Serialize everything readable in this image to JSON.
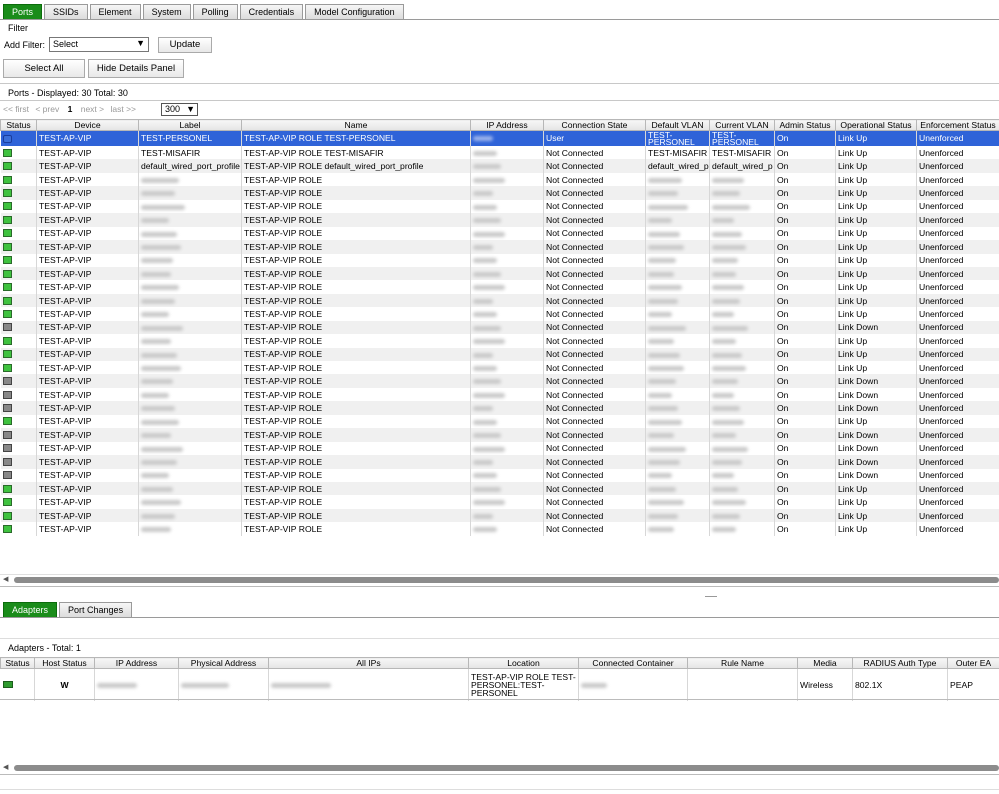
{
  "tabs": [
    "Ports",
    "SSIDs",
    "Element",
    "System",
    "Polling",
    "Credentials",
    "Model Configuration"
  ],
  "filter": {
    "title": "Filter",
    "add_label": "Add Filter:",
    "select_value": "Select",
    "update": "Update",
    "select_all": "Select All",
    "hide_details": "Hide Details Panel"
  },
  "ports_info": "Ports - Displayed: 30 Total: 30",
  "pager": {
    "first": "<< first",
    "prev": "< prev",
    "page": "1",
    "next": "next >",
    "last": "last >>",
    "per_page": "300"
  },
  "ports_columns": [
    "Status",
    "Device",
    "Label",
    "Name",
    "IP Address",
    "Connection State",
    "Default VLAN",
    "Current VLAN",
    "Admin Status",
    "Operational Status",
    "Enforcement Status"
  ],
  "ports_rows": [
    {
      "status": "user",
      "device": "TEST-AP-VIP",
      "label": "TEST-PERSONEL",
      "name": "TEST-AP-VIP ROLE TEST-PERSONEL",
      "conn": "User",
      "dvlan": "TEST-PERSONEL",
      "cvlan": "TEST-PERSONEL",
      "admin": "On",
      "oper": "Link Up",
      "enf": "Unenforced"
    },
    {
      "status": "up",
      "device": "TEST-AP-VIP",
      "label": "TEST-MISAFIR",
      "name": "TEST-AP-VIP ROLE TEST-MISAFIR",
      "conn": "Not Connected",
      "dvlan": "TEST-MISAFIR",
      "cvlan": "TEST-MISAFIR",
      "admin": "On",
      "oper": "Link Up",
      "enf": "Unenforced"
    },
    {
      "status": "up",
      "device": "TEST-AP-VIP",
      "label": "default_wired_port_profile",
      "name": "TEST-AP-VIP ROLE default_wired_port_profile",
      "conn": "Not Connected",
      "dvlan": "default_wired_p",
      "cvlan": "default_wired_p",
      "admin": "On",
      "oper": "Link Up",
      "enf": "Unenforced"
    },
    {
      "status": "up",
      "device": "TEST-AP-VIP",
      "label": "",
      "name": "TEST-AP-VIP ROLE",
      "conn": "Not Connected",
      "dvlan": "",
      "cvlan": "",
      "admin": "On",
      "oper": "Link Up",
      "enf": "Unenforced"
    },
    {
      "status": "up",
      "device": "TEST-AP-VIP",
      "label": "",
      "name": "TEST-AP-VIP ROLE",
      "conn": "Not Connected",
      "dvlan": "",
      "cvlan": "",
      "admin": "On",
      "oper": "Link Up",
      "enf": "Unenforced"
    },
    {
      "status": "up",
      "device": "TEST-AP-VIP",
      "label": "",
      "name": "TEST-AP-VIP ROLE",
      "conn": "Not Connected",
      "dvlan": "",
      "cvlan": "",
      "admin": "On",
      "oper": "Link Up",
      "enf": "Unenforced"
    },
    {
      "status": "up",
      "device": "TEST-AP-VIP",
      "label": "",
      "name": "TEST-AP-VIP ROLE",
      "conn": "Not Connected",
      "dvlan": "",
      "cvlan": "",
      "admin": "On",
      "oper": "Link Up",
      "enf": "Unenforced"
    },
    {
      "status": "up",
      "device": "TEST-AP-VIP",
      "label": "",
      "name": "TEST-AP-VIP ROLE",
      "conn": "Not Connected",
      "dvlan": "",
      "cvlan": "",
      "admin": "On",
      "oper": "Link Up",
      "enf": "Unenforced"
    },
    {
      "status": "up",
      "device": "TEST-AP-VIP",
      "label": "",
      "name": "TEST-AP-VIP ROLE",
      "conn": "Not Connected",
      "dvlan": "",
      "cvlan": "",
      "admin": "On",
      "oper": "Link Up",
      "enf": "Unenforced"
    },
    {
      "status": "up",
      "device": "TEST-AP-VIP",
      "label": "",
      "name": "TEST-AP-VIP ROLE",
      "conn": "Not Connected",
      "dvlan": "",
      "cvlan": "",
      "admin": "On",
      "oper": "Link Up",
      "enf": "Unenforced"
    },
    {
      "status": "up",
      "device": "TEST-AP-VIP",
      "label": "",
      "name": "TEST-AP-VIP ROLE",
      "conn": "Not Connected",
      "dvlan": "",
      "cvlan": "",
      "admin": "On",
      "oper": "Link Up",
      "enf": "Unenforced"
    },
    {
      "status": "up",
      "device": "TEST-AP-VIP",
      "label": "",
      "name": "TEST-AP-VIP ROLE",
      "conn": "Not Connected",
      "dvlan": "",
      "cvlan": "",
      "admin": "On",
      "oper": "Link Up",
      "enf": "Unenforced"
    },
    {
      "status": "up",
      "device": "TEST-AP-VIP",
      "label": "",
      "name": "TEST-AP-VIP ROLE",
      "conn": "Not Connected",
      "dvlan": "",
      "cvlan": "",
      "admin": "On",
      "oper": "Link Up",
      "enf": "Unenforced"
    },
    {
      "status": "up",
      "device": "TEST-AP-VIP",
      "label": "",
      "name": "TEST-AP-VIP ROLE",
      "conn": "Not Connected",
      "dvlan": "",
      "cvlan": "",
      "admin": "On",
      "oper": "Link Up",
      "enf": "Unenforced"
    },
    {
      "status": "down",
      "device": "TEST-AP-VIP",
      "label": "",
      "name": "TEST-AP-VIP ROLE",
      "conn": "Not Connected",
      "dvlan": "",
      "cvlan": "",
      "admin": "On",
      "oper": "Link Down",
      "enf": "Unenforced"
    },
    {
      "status": "up",
      "device": "TEST-AP-VIP",
      "label": "",
      "name": "TEST-AP-VIP ROLE",
      "conn": "Not Connected",
      "dvlan": "",
      "cvlan": "",
      "admin": "On",
      "oper": "Link Up",
      "enf": "Unenforced"
    },
    {
      "status": "up",
      "device": "TEST-AP-VIP",
      "label": "",
      "name": "TEST-AP-VIP ROLE",
      "conn": "Not Connected",
      "dvlan": "",
      "cvlan": "",
      "admin": "On",
      "oper": "Link Up",
      "enf": "Unenforced"
    },
    {
      "status": "up",
      "device": "TEST-AP-VIP",
      "label": "",
      "name": "TEST-AP-VIP ROLE",
      "conn": "Not Connected",
      "dvlan": "",
      "cvlan": "",
      "admin": "On",
      "oper": "Link Up",
      "enf": "Unenforced"
    },
    {
      "status": "down",
      "device": "TEST-AP-VIP",
      "label": "",
      "name": "TEST-AP-VIP ROLE",
      "conn": "Not Connected",
      "dvlan": "",
      "cvlan": "",
      "admin": "On",
      "oper": "Link Down",
      "enf": "Unenforced"
    },
    {
      "status": "down",
      "device": "TEST-AP-VIP",
      "label": "",
      "name": "TEST-AP-VIP ROLE",
      "conn": "Not Connected",
      "dvlan": "",
      "cvlan": "",
      "admin": "On",
      "oper": "Link Down",
      "enf": "Unenforced"
    },
    {
      "status": "down",
      "device": "TEST-AP-VIP",
      "label": "",
      "name": "TEST-AP-VIP ROLE",
      "conn": "Not Connected",
      "dvlan": "",
      "cvlan": "",
      "admin": "On",
      "oper": "Link Down",
      "enf": "Unenforced"
    },
    {
      "status": "up",
      "device": "TEST-AP-VIP",
      "label": "",
      "name": "TEST-AP-VIP ROLE",
      "conn": "Not Connected",
      "dvlan": "",
      "cvlan": "",
      "admin": "On",
      "oper": "Link Up",
      "enf": "Unenforced"
    },
    {
      "status": "down",
      "device": "TEST-AP-VIP",
      "label": "",
      "name": "TEST-AP-VIP ROLE",
      "conn": "Not Connected",
      "dvlan": "",
      "cvlan": "",
      "admin": "On",
      "oper": "Link Down",
      "enf": "Unenforced"
    },
    {
      "status": "down",
      "device": "TEST-AP-VIP",
      "label": "",
      "name": "TEST-AP-VIP ROLE",
      "conn": "Not Connected",
      "dvlan": "",
      "cvlan": "",
      "admin": "On",
      "oper": "Link Down",
      "enf": "Unenforced"
    },
    {
      "status": "down",
      "device": "TEST-AP-VIP",
      "label": "",
      "name": "TEST-AP-VIP ROLE",
      "conn": "Not Connected",
      "dvlan": "",
      "cvlan": "",
      "admin": "On",
      "oper": "Link Down",
      "enf": "Unenforced"
    },
    {
      "status": "down",
      "device": "TEST-AP-VIP",
      "label": "",
      "name": "TEST-AP-VIP ROLE",
      "conn": "Not Connected",
      "dvlan": "",
      "cvlan": "",
      "admin": "On",
      "oper": "Link Down",
      "enf": "Unenforced"
    },
    {
      "status": "up",
      "device": "TEST-AP-VIP",
      "label": "",
      "name": "TEST-AP-VIP ROLE",
      "conn": "Not Connected",
      "dvlan": "",
      "cvlan": "",
      "admin": "On",
      "oper": "Link Up",
      "enf": "Unenforced"
    },
    {
      "status": "up",
      "device": "TEST-AP-VIP",
      "label": "",
      "name": "TEST-AP-VIP ROLE",
      "conn": "Not Connected",
      "dvlan": "",
      "cvlan": "",
      "admin": "On",
      "oper": "Link Up",
      "enf": "Unenforced"
    },
    {
      "status": "up",
      "device": "TEST-AP-VIP",
      "label": "",
      "name": "TEST-AP-VIP ROLE",
      "conn": "Not Connected",
      "dvlan": "",
      "cvlan": "",
      "admin": "On",
      "oper": "Link Up",
      "enf": "Unenforced"
    },
    {
      "status": "up",
      "device": "TEST-AP-VIP",
      "label": "",
      "name": "TEST-AP-VIP ROLE",
      "conn": "Not Connected",
      "dvlan": "",
      "cvlan": "",
      "admin": "On",
      "oper": "Link Up",
      "enf": "Unenforced"
    }
  ],
  "bottom_tabs": [
    "Adapters",
    "Port Changes"
  ],
  "adapters_info": "Adapters - Total: 1",
  "adapter_columns": [
    "Status",
    "Host Status",
    "IP Address",
    "Physical Address",
    "All IPs",
    "Location",
    "Connected Container",
    "Rule Name",
    "Media",
    "RADIUS Auth Type",
    "Outer EA"
  ],
  "adapter_row": {
    "host_status": "W",
    "location": "TEST-AP-VIP ROLE TEST-PERSONEL:TEST-PERSONEL",
    "rule_name": "",
    "media": "Wireless",
    "radius": "802.1X",
    "outer": "PEAP"
  },
  "colors": {
    "tab_active": "#1a8c1a",
    "selection": "#2f63d8",
    "status_up": "#3fc23f",
    "status_down": "#888888"
  }
}
